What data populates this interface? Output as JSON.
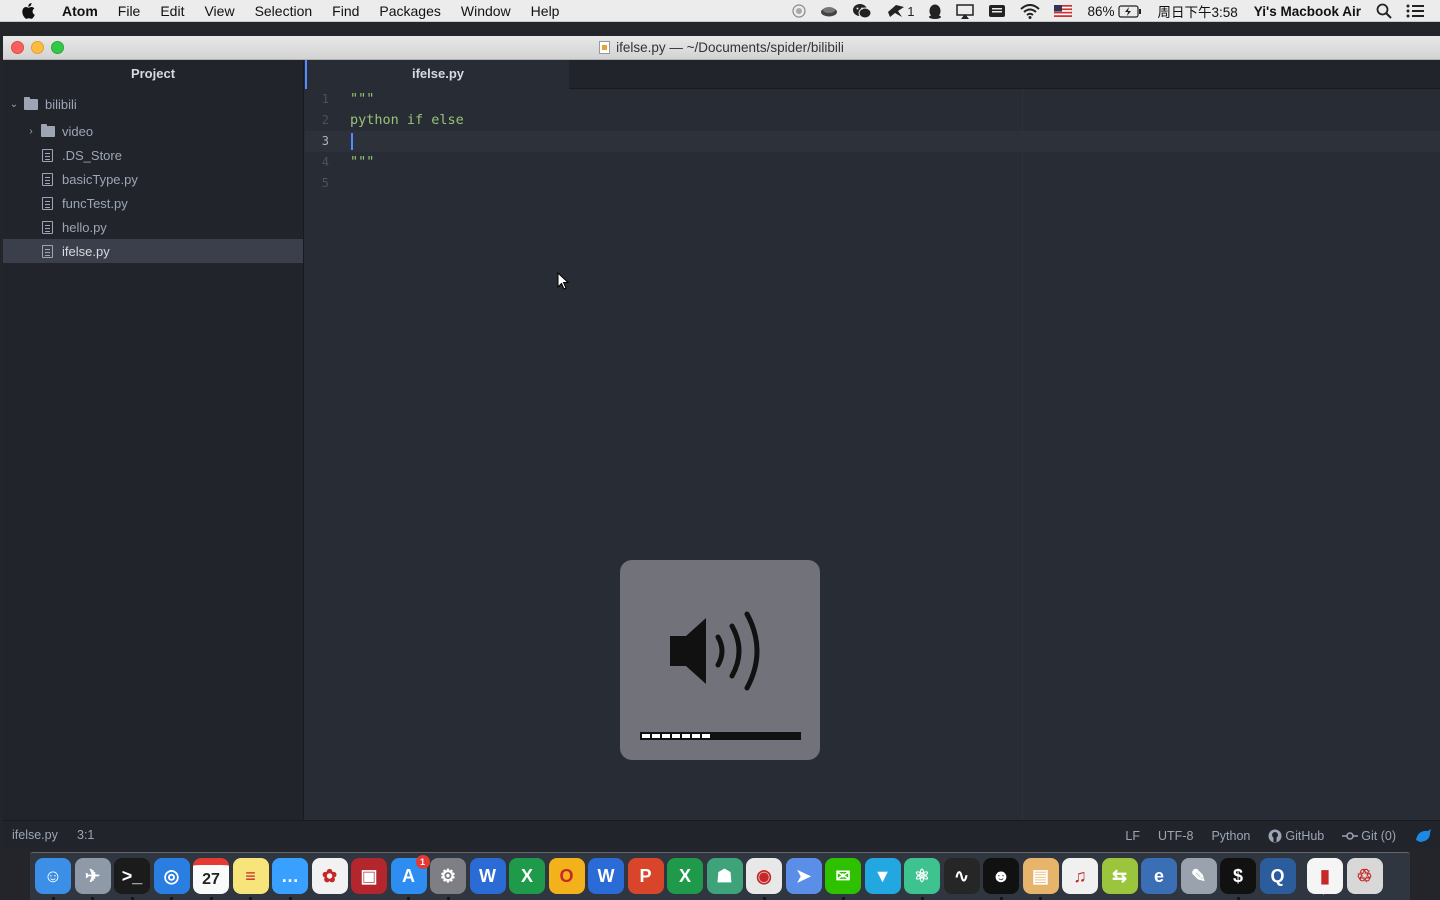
{
  "menubar": {
    "app_name": "Atom",
    "items": [
      "File",
      "Edit",
      "View",
      "Selection",
      "Find",
      "Packages",
      "Window",
      "Help"
    ],
    "status": {
      "qq_count": "1",
      "battery": "86%",
      "clock": "周日下午3:58",
      "user": "Yi's Macbook Air"
    }
  },
  "window": {
    "title": "ifelse.py — ~/Documents/spider/bilibili"
  },
  "tree": {
    "header": "Project",
    "root": "bilibili",
    "folders": [
      "video"
    ],
    "files": [
      ".DS_Store",
      "basicType.py",
      "funcTest.py",
      "hello.py",
      "ifelse.py"
    ]
  },
  "editor": {
    "tab": "ifelse.py",
    "lines": [
      "\"\"\"",
      "python if else",
      "",
      "\"\"\"",
      ""
    ],
    "line_numbers": [
      "1",
      "2",
      "3",
      "4",
      "5"
    ]
  },
  "statusbar": {
    "file": "ifelse.py",
    "cursor": "3:1",
    "line_ending": "LF",
    "encoding": "UTF-8",
    "grammar": "Python",
    "github": "GitHub",
    "git": "Git (0)"
  },
  "volume": {
    "level_percent": 44,
    "segments_total": 16,
    "segments_filled": 7
  },
  "dock": {
    "apps": [
      "finder",
      "launchpad",
      "terminal",
      "safari",
      "calendar",
      "notes",
      "messages",
      "photos",
      "photo-booth",
      "app-store",
      "system-preferences",
      "word",
      "excel",
      "outlook",
      "word-alt",
      "powerpoint",
      "excel-alt",
      "network-utility",
      "chrome",
      "maps",
      "wechat",
      "flowchart",
      "atom",
      "activity-monitor",
      "qq",
      "archive",
      "itunes",
      "android-file",
      "ie",
      "preview",
      "terminal-alt",
      "quicktime",
      "downloads",
      "trash"
    ],
    "calendar_date": "27",
    "appstore_badge": "1"
  }
}
